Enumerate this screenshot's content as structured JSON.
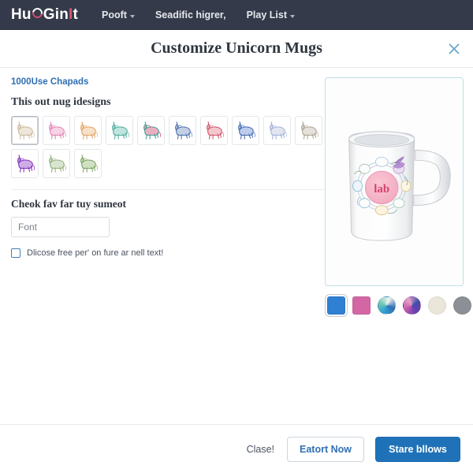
{
  "navbar": {
    "logo": {
      "pre": "Hu",
      "mid": "Gin",
      "bar": "I",
      "post": "t",
      "ring_icon": "unicorn-ring-icon"
    },
    "items": [
      {
        "label": "Pooft",
        "has_caret": true
      },
      {
        "label": "Seadific higrer,",
        "has_caret": false
      },
      {
        "label": "Play List",
        "has_caret": true
      }
    ],
    "background": "#343a49"
  },
  "modal": {
    "title": "Customize Unicorn Mugs",
    "close_icon": "close-icon",
    "sub_link": "1000Use Chapads",
    "designs": {
      "section_title": "This out nug idesigns",
      "selected_index": 0,
      "items": [
        {
          "name": "unicorn-design-1",
          "color": "#c9b79a",
          "accent": "#ded3bc"
        },
        {
          "name": "unicorn-design-2",
          "color": "#e07fb4",
          "accent": "#f0aed0"
        },
        {
          "name": "unicorn-design-3",
          "color": "#e0a05c",
          "accent": "#f0c79a"
        },
        {
          "name": "unicorn-design-4",
          "color": "#4aa99a",
          "accent": "#8dcfc4"
        },
        {
          "name": "unicorn-design-5",
          "color": "#3f9e95",
          "accent": "#d4708f"
        },
        {
          "name": "unicorn-design-6",
          "color": "#4b6fa8",
          "accent": "#8fa7cd"
        },
        {
          "name": "unicorn-design-7",
          "color": "#cf4f63",
          "accent": "#e89aa6"
        },
        {
          "name": "unicorn-design-8",
          "color": "#3f63b0",
          "accent": "#86a3d8"
        },
        {
          "name": "unicorn-design-9",
          "color": "#9fb0d4",
          "accent": "#c8d2e7"
        },
        {
          "name": "unicorn-design-10",
          "color": "#a9a090",
          "accent": "#cfc8bb"
        },
        {
          "name": "unicorn-design-11",
          "color": "#7d2fb5",
          "accent": "#a866d6"
        },
        {
          "name": "unicorn-design-12",
          "color": "#8fae7a",
          "accent": "#bcd0ab"
        },
        {
          "name": "unicorn-design-13",
          "color": "#79a05f",
          "accent": "#aac78f"
        }
      ]
    },
    "text_field": {
      "label": "Cheok fav far tuy sumeot",
      "placeholder": "Font",
      "value": ""
    },
    "checkbox": {
      "label": "Dlicose free per' on fure ar nell text!",
      "checked": false
    },
    "preview": {
      "name": "mug-preview",
      "mug_label": "lab",
      "swatches": [
        {
          "name": "swatch-blue",
          "shape": "sq",
          "color": "#2f80d2",
          "selected": true
        },
        {
          "name": "swatch-pink",
          "shape": "sq",
          "color": "#d267a4",
          "selected": false
        },
        {
          "name": "swatch-teal-gradient",
          "shape": "ci",
          "color": "#2f9fd2",
          "selected": false
        },
        {
          "name": "swatch-purple-gradient",
          "shape": "ci",
          "color": "#6b3fb5",
          "selected": false
        },
        {
          "name": "swatch-cream",
          "shape": "ci",
          "color": "#eae6da",
          "selected": false
        },
        {
          "name": "swatch-gray",
          "shape": "ci",
          "color": "#8c9096",
          "selected": false
        }
      ]
    },
    "footer": {
      "cancel_label": "Clase!",
      "secondary_label": "Eatort Now",
      "primary_label": "Stare bllows"
    }
  }
}
